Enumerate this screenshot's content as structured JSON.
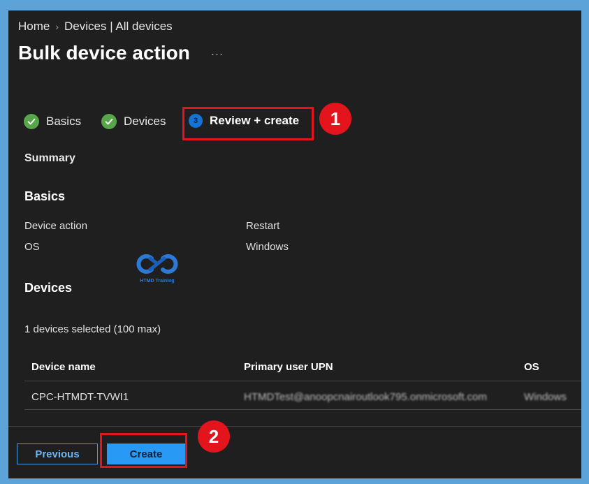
{
  "breadcrumb": {
    "home": "Home",
    "separator": "›",
    "current": "Devices | All devices"
  },
  "page": {
    "title": "Bulk device action",
    "more": "···"
  },
  "steps": [
    {
      "label": "Basics",
      "state": "complete"
    },
    {
      "label": "Devices",
      "state": "complete"
    },
    {
      "label": "Review + create",
      "state": "current",
      "number": "3"
    }
  ],
  "callouts": {
    "first": "1",
    "second": "2"
  },
  "summary": {
    "label": "Summary"
  },
  "basics": {
    "heading": "Basics",
    "rows": [
      {
        "key": "Device action",
        "value": "Restart"
      },
      {
        "key": "OS",
        "value": "Windows"
      }
    ]
  },
  "watermark": {
    "text": "HTMD Training"
  },
  "devices": {
    "heading": "Devices",
    "selected_count": "1 devices selected (100 max)",
    "columns": [
      "Device name",
      "Primary user UPN",
      "OS"
    ],
    "rows": [
      {
        "name": "CPC-HTMDT-TVWI1",
        "upn": "HTMDTest@anoopcnairoutlook795.onmicrosoft.com",
        "os": "Windows"
      }
    ]
  },
  "buttons": {
    "previous": "Previous",
    "create": "Create"
  },
  "colors": {
    "accent": "#2899f5",
    "highlight": "#e3141b",
    "success": "#57a64a",
    "background": "#1f1f1f",
    "frame": "#5ba3d9"
  }
}
